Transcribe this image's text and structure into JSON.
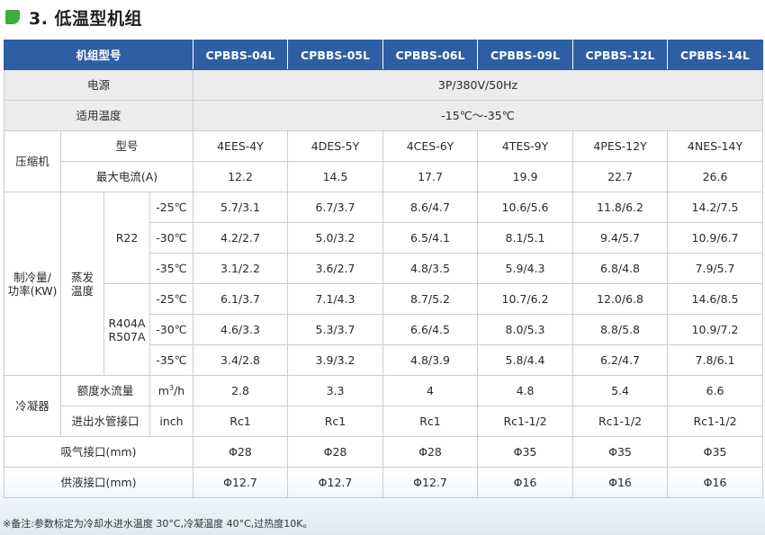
{
  "heading": {
    "title": "3. 低温型机组"
  },
  "header": {
    "label": "机组型号",
    "models": [
      "CPBBS-04L",
      "CPBBS-05L",
      "CPBBS-06L",
      "CPBBS-09L",
      "CPBBS-12L",
      "CPBBS-14L"
    ]
  },
  "power": {
    "label": "电源",
    "value": "3P/380V/50Hz"
  },
  "temp_range": {
    "label": "适用温度",
    "value": "-15℃～-35℃"
  },
  "compressor": {
    "label": "压缩机",
    "model": {
      "label": "型号",
      "values": [
        "4EES-4Y",
        "4DES-5Y",
        "4CES-6Y",
        "4TES-9Y",
        "4PES-12Y",
        "4NES-14Y"
      ]
    },
    "max_current": {
      "label": "最大电流(A)",
      "values": [
        "12.2",
        "14.5",
        "17.7",
        "19.9",
        "22.7",
        "26.6"
      ]
    }
  },
  "capacity": {
    "label_line1": "制冷量/",
    "label_line2": "功率(KW)",
    "evap_line1": "蒸发",
    "evap_line2": "温度",
    "groups": [
      {
        "refrigerant_line1": "R22",
        "refrigerant_line2": "",
        "rows": [
          {
            "temp": "-25℃",
            "values": [
              "5.7/3.1",
              "6.7/3.7",
              "8.6/4.7",
              "10.6/5.6",
              "11.8/6.2",
              "14.2/7.5"
            ]
          },
          {
            "temp": "-30℃",
            "values": [
              "4.2/2.7",
              "5.0/3.2",
              "6.5/4.1",
              "8.1/5.1",
              "9.4/5.7",
              "10.9/6.7"
            ]
          },
          {
            "temp": "-35℃",
            "values": [
              "3.1/2.2",
              "3.6/2.7",
              "4.8/3.5",
              "5.9/4.3",
              "6.8/4.8",
              "7.9/5.7"
            ]
          }
        ]
      },
      {
        "refrigerant_line1": "R404A",
        "refrigerant_line2": "R507A",
        "rows": [
          {
            "temp": "-25℃",
            "values": [
              "6.1/3.7",
              "7.1/4.3",
              "8.7/5.2",
              "10.7/6.2",
              "12.0/6.8",
              "14.6/8.5"
            ]
          },
          {
            "temp": "-30℃",
            "values": [
              "4.6/3.3",
              "5.3/3.7",
              "6.6/4.5",
              "8.0/5.3",
              "8.8/5.8",
              "10.9/7.2"
            ]
          },
          {
            "temp": "-35℃",
            "values": [
              "3.4/2.8",
              "3.9/3.2",
              "4.8/3.9",
              "5.8/4.4",
              "6.2/4.7",
              "7.8/6.1"
            ]
          }
        ]
      }
    ]
  },
  "condenser": {
    "label": "冷凝器",
    "flow": {
      "label": "额度水流量",
      "unit_base": "m",
      "unit_sup": "3",
      "unit_tail": "/h",
      "values": [
        "2.8",
        "3.3",
        "4",
        "4.8",
        "5.4",
        "6.6"
      ]
    },
    "pipe": {
      "label": "进出水管接口",
      "unit": "inch",
      "values": [
        "Rc1",
        "Rc1",
        "Rc1",
        "Rc1-1/2",
        "Rc1-1/2",
        "Rc1-1/2"
      ]
    }
  },
  "suction": {
    "label": "吸气接口(mm)",
    "values": [
      "Φ28",
      "Φ28",
      "Φ28",
      "Φ35",
      "Φ35",
      "Φ35"
    ]
  },
  "liquid": {
    "label": "供液接口(mm)",
    "values": [
      "Φ12.7",
      "Φ12.7",
      "Φ12.7",
      "Φ16",
      "Φ16",
      "Φ16"
    ]
  },
  "note": "※备注:参数标定为冷却水进水温度 30°C,冷凝温度 40°C,过热度10K。",
  "colors": {
    "header_bg": "#2e5ea4",
    "shade": "#ececed",
    "leaf": "#3cae3f"
  }
}
